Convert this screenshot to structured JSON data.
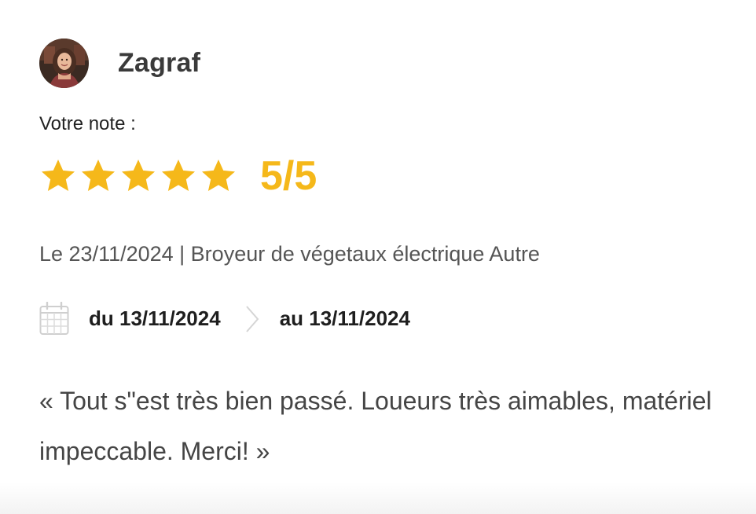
{
  "review": {
    "author": "Zagraf",
    "note_label": "Votre note :",
    "rating": {
      "stars_filled": 5,
      "stars_total": 5,
      "score_text": "5/5",
      "color": "#f5b81a"
    },
    "meta": "Le 23/11/2024 | Broyeur de végetaux électrique Autre",
    "period": {
      "from": "du 13/11/2024",
      "to": "au 13/11/2024"
    },
    "comment": "« Tout s\"est très bien passé. Loueurs très aimables, matériel impeccable. Merci! »"
  },
  "icons": {
    "avatar": "user-avatar-photo",
    "calendar": "calendar-icon",
    "separator": "chevron-right-icon",
    "star": "star-icon"
  }
}
